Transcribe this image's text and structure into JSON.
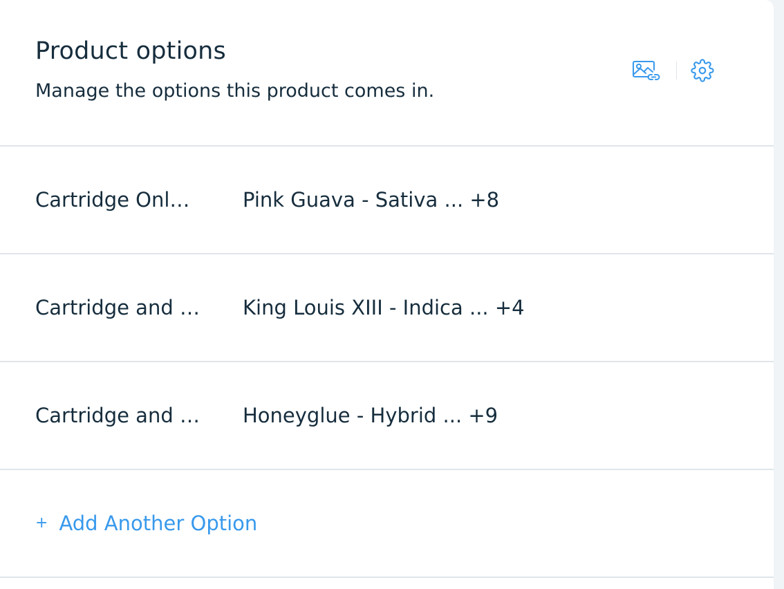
{
  "section": {
    "title": "Product options",
    "subtitle": "Manage the options this product comes in.",
    "actions": [
      {
        "icon": "image-link-icon"
      },
      {
        "icon": "gear-icon"
      }
    ]
  },
  "options": [
    {
      "name": "Cartridge Onl…",
      "values": "Pink Guava - Sativa ... +8"
    },
    {
      "name": "Cartridge and …",
      "values": "King Louis XIII - Indica ... +4"
    },
    {
      "name": "Cartridge and …",
      "values": "Honeyglue - Hybrid ... +9"
    }
  ],
  "add_option": {
    "plus": "+",
    "label": "Add Another Option"
  },
  "colors": {
    "text": "#162d3d",
    "accent": "#3899ec",
    "divider": "#dfe5eb"
  }
}
